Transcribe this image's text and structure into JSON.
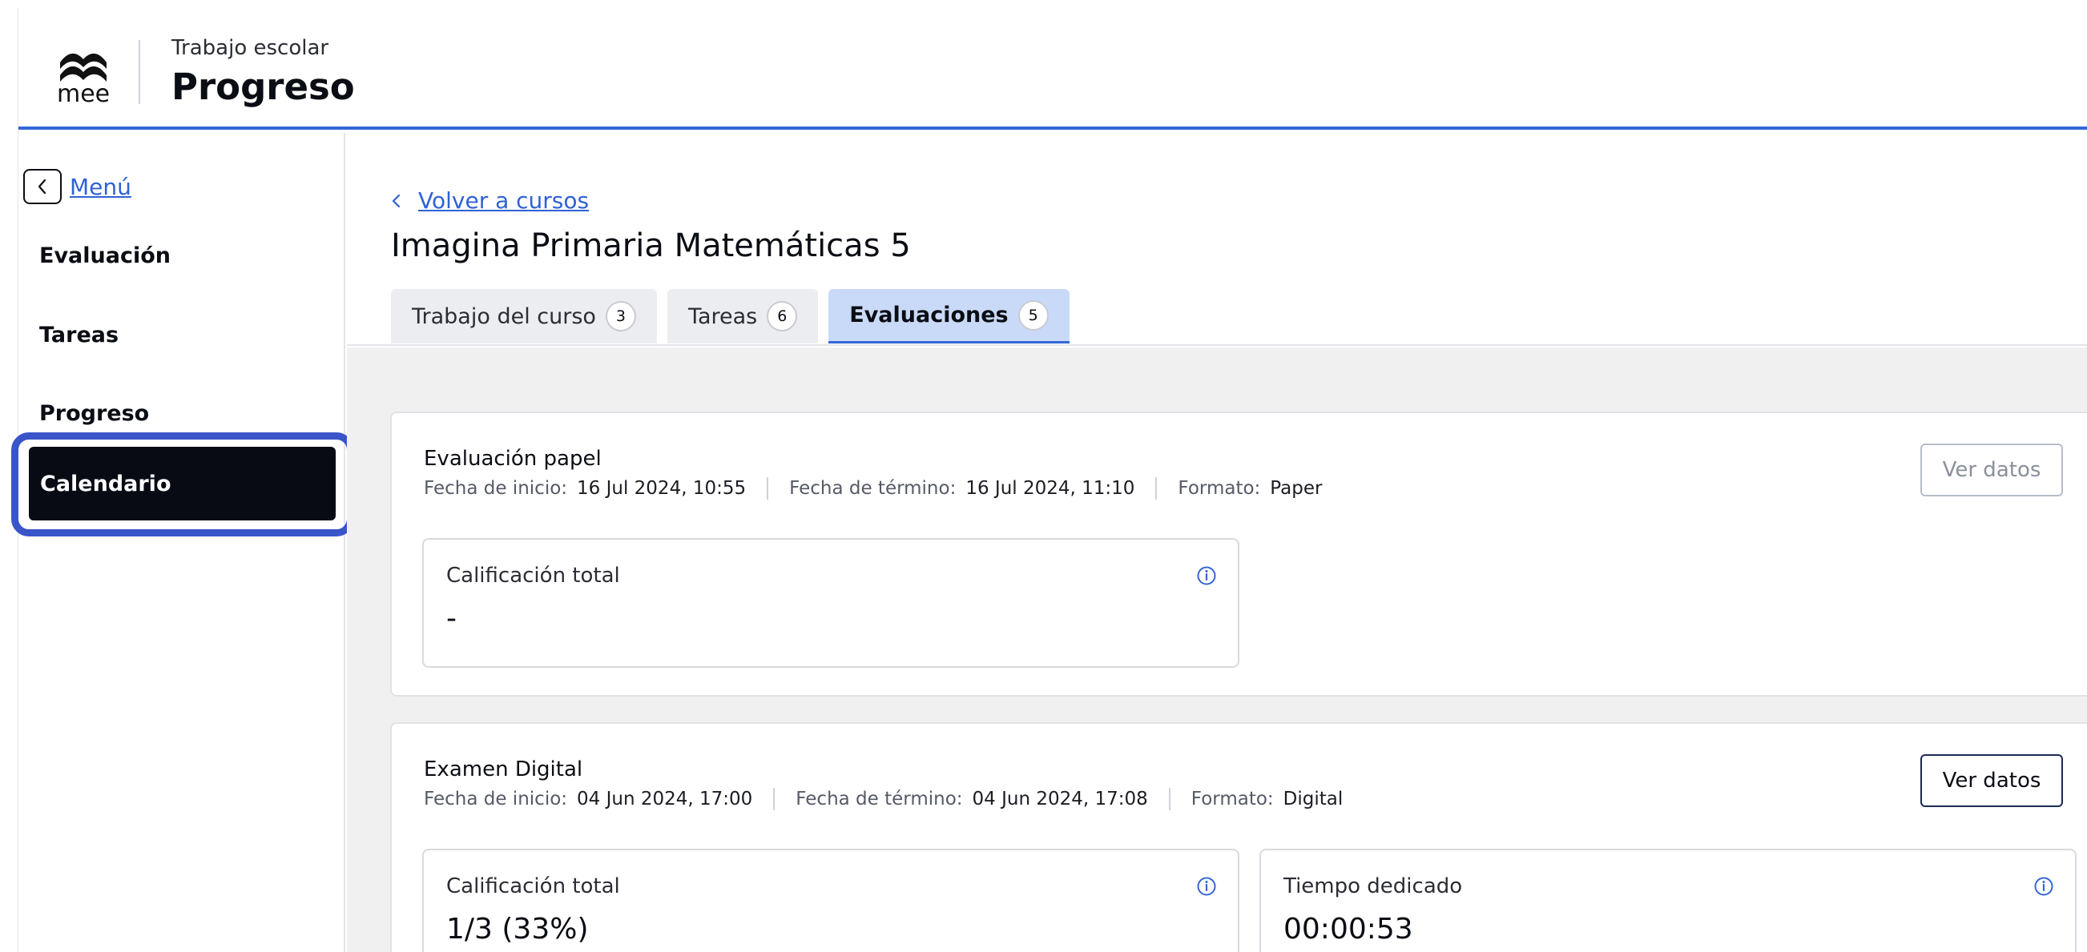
{
  "header": {
    "logo_text": "mee",
    "subtitle": "Trabajo escolar",
    "title": "Progreso"
  },
  "sidebar": {
    "menu_label": "Menú",
    "items": [
      {
        "label": "Evaluación"
      },
      {
        "label": "Tareas"
      },
      {
        "label": "Progreso"
      },
      {
        "label": "Calendario",
        "active": true
      }
    ]
  },
  "main": {
    "back_label": "Volver a cursos",
    "course_title": "Imagina Primaria Matemáticas 5",
    "tabs": [
      {
        "label": "Trabajo del curso",
        "count": "3"
      },
      {
        "label": "Tareas",
        "count": "6"
      },
      {
        "label": "Evaluaciones",
        "count": "5",
        "active": true
      }
    ],
    "assessments": [
      {
        "title": "Evaluación papel",
        "start_label": "Fecha de inicio:",
        "start_value": "16 Jul 2024, 10:55",
        "end_label": "Fecha de término:",
        "end_value": "16 Jul 2024, 11:10",
        "format_label": "Formato:",
        "format_value": "Paper",
        "button_label": "Ver datos",
        "button_enabled": false,
        "stats": [
          {
            "label": "Calificación total",
            "value": "-"
          }
        ]
      },
      {
        "title": "Examen Digital",
        "start_label": "Fecha de inicio:",
        "start_value": "04 Jun 2024, 17:00",
        "end_label": "Fecha de término:",
        "end_value": "04 Jun 2024, 17:08",
        "format_label": "Formato:",
        "format_value": "Digital",
        "button_label": "Ver datos",
        "button_enabled": true,
        "stats": [
          {
            "label": "Calificación total",
            "value": "1/3 (33%)"
          },
          {
            "label": "Tiempo dedicado",
            "value": "00:00:53"
          }
        ]
      }
    ]
  },
  "colors": {
    "accent": "#3566d6",
    "link": "#2f62d4",
    "active_nav_bg": "#080b14",
    "focus_ring": "#3a55c9",
    "active_tab_bg": "#c9daf8",
    "content_bg": "#f0f0f0"
  },
  "icons": [
    "mee-logo-icon",
    "chevron-left-icon",
    "info-icon"
  ]
}
